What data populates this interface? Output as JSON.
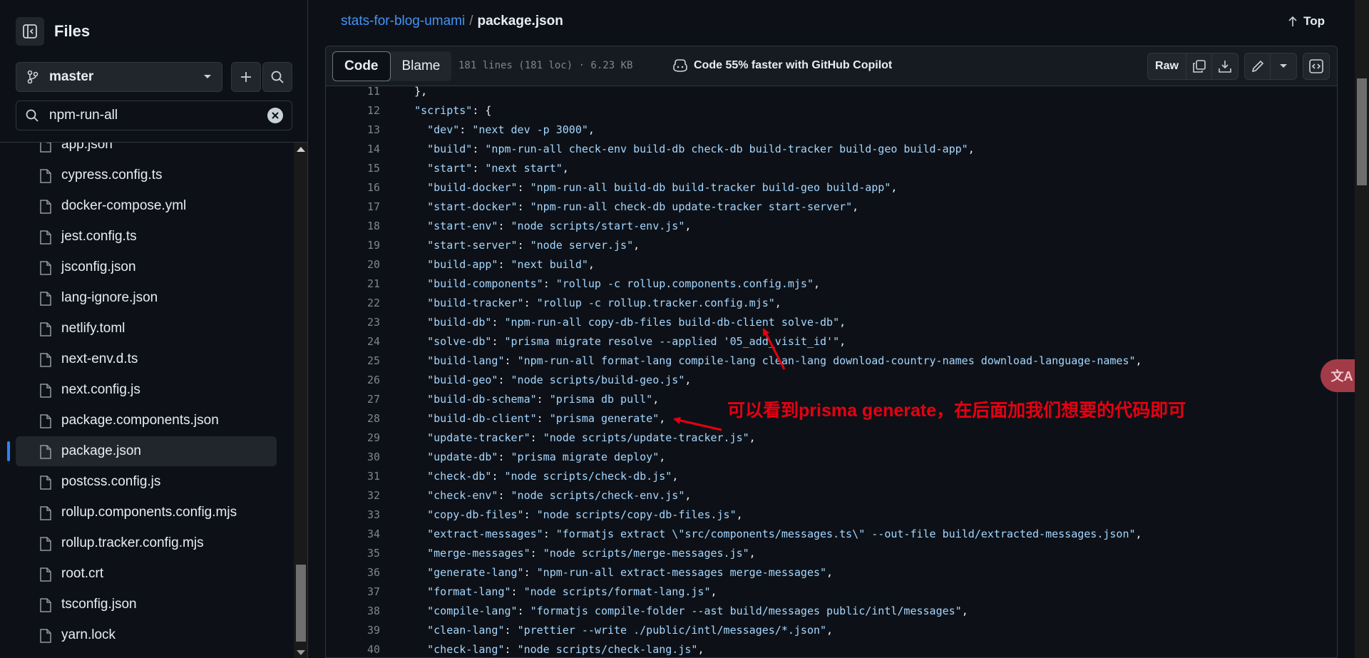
{
  "sidebar": {
    "title": "Files",
    "branch": "master",
    "search_value": "npm-run-all",
    "files": [
      "app.json",
      "cypress.config.ts",
      "docker-compose.yml",
      "jest.config.ts",
      "jsconfig.json",
      "lang-ignore.json",
      "netlify.toml",
      "next-env.d.ts",
      "next.config.js",
      "package.components.json",
      "package.json",
      "postcss.config.js",
      "rollup.components.config.mjs",
      "rollup.tracker.config.mjs",
      "root.crt",
      "tsconfig.json",
      "yarn.lock"
    ],
    "active_file": "package.json"
  },
  "header": {
    "repo": "stats-for-blog-umami",
    "separator": "/",
    "file": "package.json",
    "top_label": "Top"
  },
  "toolbar": {
    "code_tab": "Code",
    "blame_tab": "Blame",
    "file_info": "181 lines (181 loc) · 6.23 KB",
    "copilot_text": "Code 55% faster with GitHub Copilot",
    "raw_label": "Raw"
  },
  "code_lines": [
    {
      "n": "11",
      "indent": "  ",
      "key": "",
      "val": "},"
    },
    {
      "n": "12",
      "indent": "  ",
      "key": "\"scripts\"",
      "val": ": {"
    },
    {
      "n": "13",
      "indent": "    ",
      "key": "\"dev\"",
      "val": ": \"next dev -p 3000\","
    },
    {
      "n": "14",
      "indent": "    ",
      "key": "\"build\"",
      "val": ": \"npm-run-all check-env build-db check-db build-tracker build-geo build-app\","
    },
    {
      "n": "15",
      "indent": "    ",
      "key": "\"start\"",
      "val": ": \"next start\","
    },
    {
      "n": "16",
      "indent": "    ",
      "key": "\"build-docker\"",
      "val": ": \"npm-run-all build-db build-tracker build-geo build-app\","
    },
    {
      "n": "17",
      "indent": "    ",
      "key": "\"start-docker\"",
      "val": ": \"npm-run-all check-db update-tracker start-server\","
    },
    {
      "n": "18",
      "indent": "    ",
      "key": "\"start-env\"",
      "val": ": \"node scripts/start-env.js\","
    },
    {
      "n": "19",
      "indent": "    ",
      "key": "\"start-server\"",
      "val": ": \"node server.js\","
    },
    {
      "n": "20",
      "indent": "    ",
      "key": "\"build-app\"",
      "val": ": \"next build\","
    },
    {
      "n": "21",
      "indent": "    ",
      "key": "\"build-components\"",
      "val": ": \"rollup -c rollup.components.config.mjs\","
    },
    {
      "n": "22",
      "indent": "    ",
      "key": "\"build-tracker\"",
      "val": ": \"rollup -c rollup.tracker.config.mjs\","
    },
    {
      "n": "23",
      "indent": "    ",
      "key": "\"build-db\"",
      "val": ": \"npm-run-all copy-db-files build-db-client solve-db\","
    },
    {
      "n": "24",
      "indent": "    ",
      "key": "\"solve-db\"",
      "val": ": \"prisma migrate resolve --applied '05_add_visit_id'\","
    },
    {
      "n": "25",
      "indent": "    ",
      "key": "\"build-lang\"",
      "val": ": \"npm-run-all format-lang compile-lang clean-lang download-country-names download-language-names\","
    },
    {
      "n": "26",
      "indent": "    ",
      "key": "\"build-geo\"",
      "val": ": \"node scripts/build-geo.js\","
    },
    {
      "n": "27",
      "indent": "    ",
      "key": "\"build-db-schema\"",
      "val": ": \"prisma db pull\","
    },
    {
      "n": "28",
      "indent": "    ",
      "key": "\"build-db-client\"",
      "val": ": \"prisma generate\","
    },
    {
      "n": "29",
      "indent": "    ",
      "key": "\"update-tracker\"",
      "val": ": \"node scripts/update-tracker.js\","
    },
    {
      "n": "30",
      "indent": "    ",
      "key": "\"update-db\"",
      "val": ": \"prisma migrate deploy\","
    },
    {
      "n": "31",
      "indent": "    ",
      "key": "\"check-db\"",
      "val": ": \"node scripts/check-db.js\","
    },
    {
      "n": "32",
      "indent": "    ",
      "key": "\"check-env\"",
      "val": ": \"node scripts/check-env.js\","
    },
    {
      "n": "33",
      "indent": "    ",
      "key": "\"copy-db-files\"",
      "val": ": \"node scripts/copy-db-files.js\","
    },
    {
      "n": "34",
      "indent": "    ",
      "key": "\"extract-messages\"",
      "val": ": \"formatjs extract \\\"src/components/messages.ts\\\" --out-file build/extracted-messages.json\","
    },
    {
      "n": "35",
      "indent": "    ",
      "key": "\"merge-messages\"",
      "val": ": \"node scripts/merge-messages.js\","
    },
    {
      "n": "36",
      "indent": "    ",
      "key": "\"generate-lang\"",
      "val": ": \"npm-run-all extract-messages merge-messages\","
    },
    {
      "n": "37",
      "indent": "    ",
      "key": "\"format-lang\"",
      "val": ": \"node scripts/format-lang.js\","
    },
    {
      "n": "38",
      "indent": "    ",
      "key": "\"compile-lang\"",
      "val": ": \"formatjs compile-folder --ast build/messages public/intl/messages\","
    },
    {
      "n": "39",
      "indent": "    ",
      "key": "\"clean-lang\"",
      "val": ": \"prettier --write ./public/intl/messages/*.json\","
    },
    {
      "n": "40",
      "indent": "    ",
      "key": "\"check-lang\"",
      "val": ": \"node scripts/check-lang.js\","
    }
  ],
  "annotation": {
    "text": "可以看到prisma generate，在后面加我们想要的代码即可",
    "color": "#e60012"
  },
  "translate_fab": "文A",
  "colors": {
    "background": "#0d1117",
    "accent": "#2f81f7",
    "link": "#4493f8",
    "string": "#a5d6ff"
  }
}
